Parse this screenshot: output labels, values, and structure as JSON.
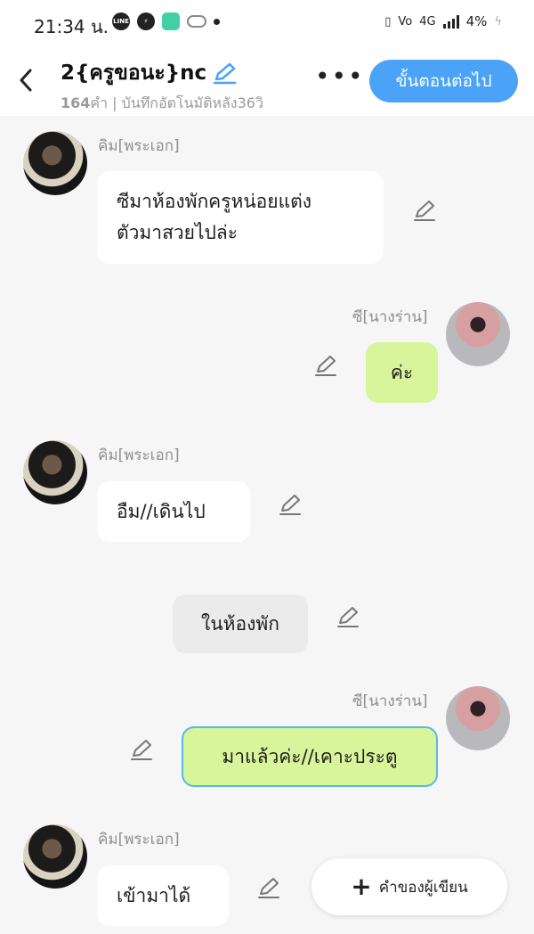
{
  "status_bar": {
    "time": "21:34 น.",
    "apps": [
      "line-icon",
      "messenger-icon",
      "calculator-icon",
      "game-controller-icon"
    ],
    "network": "4G",
    "battery": "4%"
  },
  "header": {
    "title": "2{ครูขอนะ}nc",
    "word_count": "164",
    "word_unit": "คำ",
    "autosave": "บันทึกอัตโนมัติหลัง36วิ",
    "next_button": "ขั้นตอนต่อไป",
    "colors": {
      "accent": "#4aa3f7"
    }
  },
  "messages": [
    {
      "side": "left",
      "speaker": "คิม[พระเอก]",
      "text_line1": "ซีมาห้องพักครูหน่อยแต่ง",
      "text_line2": "ตัวมาสวยไปล่ะ"
    },
    {
      "side": "right",
      "speaker": "ซี[นางร่าน]",
      "text": "ค่ะ"
    },
    {
      "side": "left",
      "speaker": "คิม[พระเอก]",
      "text": "อืม//เดินไป"
    },
    {
      "side": "narration",
      "text": "ในห้องพัก"
    },
    {
      "side": "right",
      "speaker": "ซี[นางร่าน]",
      "text": "มาแล้วค่ะ//เคาะประตู"
    },
    {
      "side": "left",
      "speaker": "คิม[พระเอก]",
      "text": "เข้ามาได้"
    }
  ],
  "writer_button": "คำของผู้เขียน"
}
